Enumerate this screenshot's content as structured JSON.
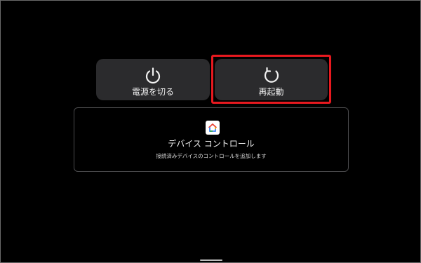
{
  "power_menu": {
    "power_off": {
      "label": "電源を切る",
      "icon": "power-icon"
    },
    "restart": {
      "label": "再起動",
      "icon": "restart-icon",
      "highlighted": true
    }
  },
  "device_controls": {
    "icon": "google-home-icon",
    "title": "デバイス コントロール",
    "subtitle": "接続済みデバイスのコントロールを追加します"
  },
  "colors": {
    "background": "#000000",
    "button_bg": "#2b2b2d",
    "highlight": "#e8191f",
    "text": "#f1f1f1"
  }
}
